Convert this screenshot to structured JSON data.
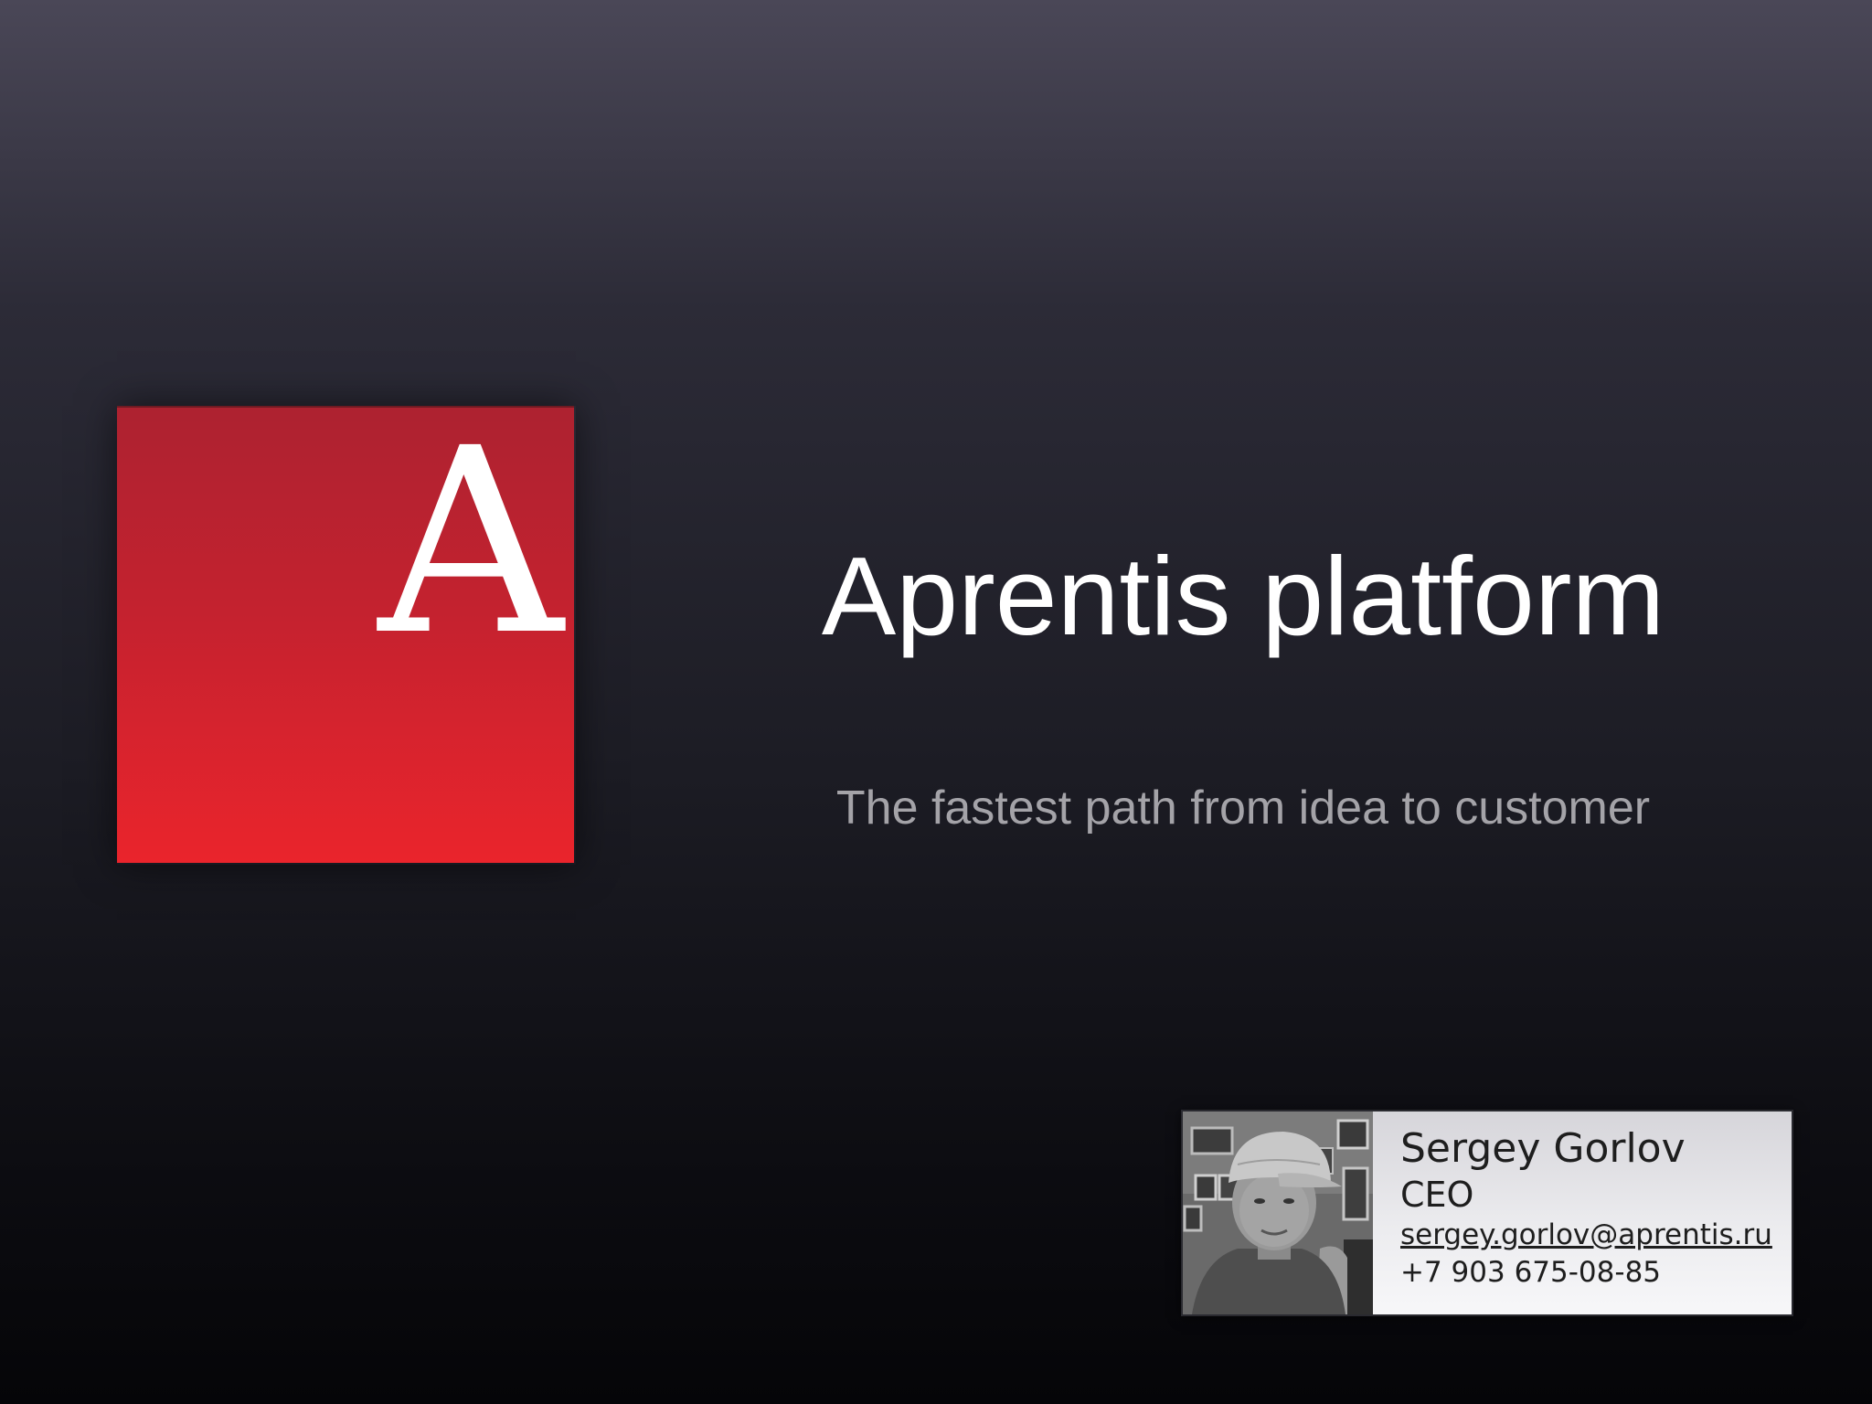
{
  "slide": {
    "logo": {
      "letter": "A",
      "color_top": "#ad2230",
      "color_bottom": "#ea242c"
    },
    "title": "Aprentis platform",
    "subtitle": "The fastest path from idea to customer"
  },
  "contact_card": {
    "name": "Sergey Gorlov",
    "role": "CEO",
    "email": "sergey.gorlov@aprentis.ru",
    "phone": "+7 903 675-08-85",
    "photo_icon": "person-photo"
  }
}
